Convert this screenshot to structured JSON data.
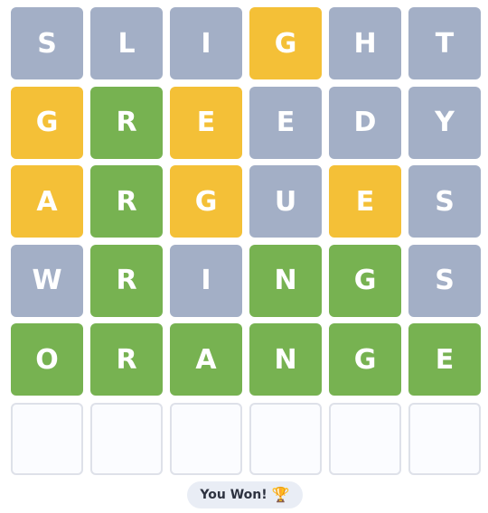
{
  "board": {
    "rows": [
      [
        {
          "letter": "S",
          "state": "absent"
        },
        {
          "letter": "L",
          "state": "absent"
        },
        {
          "letter": "I",
          "state": "absent"
        },
        {
          "letter": "G",
          "state": "present"
        },
        {
          "letter": "H",
          "state": "absent"
        },
        {
          "letter": "T",
          "state": "absent"
        }
      ],
      [
        {
          "letter": "G",
          "state": "present"
        },
        {
          "letter": "R",
          "state": "correct"
        },
        {
          "letter": "E",
          "state": "present"
        },
        {
          "letter": "E",
          "state": "absent"
        },
        {
          "letter": "D",
          "state": "absent"
        },
        {
          "letter": "Y",
          "state": "absent"
        }
      ],
      [
        {
          "letter": "A",
          "state": "present"
        },
        {
          "letter": "R",
          "state": "correct"
        },
        {
          "letter": "G",
          "state": "present"
        },
        {
          "letter": "U",
          "state": "absent"
        },
        {
          "letter": "E",
          "state": "present"
        },
        {
          "letter": "S",
          "state": "absent"
        }
      ],
      [
        {
          "letter": "W",
          "state": "absent"
        },
        {
          "letter": "R",
          "state": "correct"
        },
        {
          "letter": "I",
          "state": "absent"
        },
        {
          "letter": "N",
          "state": "correct"
        },
        {
          "letter": "G",
          "state": "correct"
        },
        {
          "letter": "S",
          "state": "absent"
        }
      ],
      [
        {
          "letter": "O",
          "state": "correct"
        },
        {
          "letter": "R",
          "state": "correct"
        },
        {
          "letter": "A",
          "state": "correct"
        },
        {
          "letter": "N",
          "state": "correct"
        },
        {
          "letter": "G",
          "state": "correct"
        },
        {
          "letter": "E",
          "state": "correct"
        }
      ],
      [
        {
          "letter": "",
          "state": "empty"
        },
        {
          "letter": "",
          "state": "empty"
        },
        {
          "letter": "",
          "state": "empty"
        },
        {
          "letter": "",
          "state": "empty"
        },
        {
          "letter": "",
          "state": "empty"
        },
        {
          "letter": "",
          "state": "empty"
        }
      ]
    ]
  },
  "status": {
    "text": "You Won!",
    "icon": "trophy-icon",
    "icon_glyph": "🏆"
  },
  "colors": {
    "absent": "#a3afc6",
    "present": "#f4c037",
    "correct": "#77b251",
    "empty_bg": "#fbfcff",
    "empty_border": "#dee1e9"
  }
}
